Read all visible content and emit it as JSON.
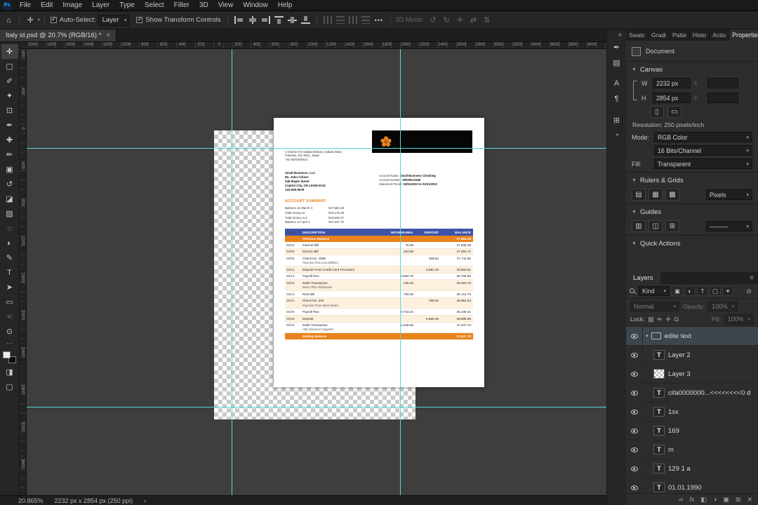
{
  "app": {
    "title_tab": "Italy id.psd @ 20.7% (RGB/16) *",
    "close_glyph": "×",
    "app_icon": "Ps"
  },
  "menubar": {
    "items": [
      "File",
      "Edit",
      "Image",
      "Layer",
      "Type",
      "Select",
      "Filter",
      "3D",
      "View",
      "Window",
      "Help"
    ]
  },
  "options_bar": {
    "home_icon": "⌂",
    "tool_icon": "✛",
    "auto_select": {
      "checked": true,
      "label": "Auto-Select:",
      "value": "Layer"
    },
    "show_transform": {
      "checked": true,
      "label": "Show Transform Controls"
    },
    "align_icons": [
      {
        "name": "align-left-edges-icon",
        "variant": "a-l"
      },
      {
        "name": "align-horizontal-centers-icon",
        "variant": "a-ch"
      },
      {
        "name": "align-right-edges-icon",
        "variant": "a-r"
      },
      {
        "name": "align-top-edges-icon",
        "variant": "a-t"
      },
      {
        "name": "align-vertical-centers-icon",
        "variant": "a-cv"
      },
      {
        "name": "align-bottom-edges-icon",
        "variant": "a-b"
      }
    ],
    "distribute_icons": [
      {
        "name": "distribute-horizontal-icon",
        "variant": "v"
      },
      {
        "name": "distribute-vertical-icon",
        "variant": "h"
      },
      {
        "name": "distribute-spacing-h-icon",
        "variant": "v"
      },
      {
        "name": "distribute-spacing-v-icon",
        "variant": "h"
      }
    ],
    "more_icon": "•••",
    "mode_3d_label": "3D Mode:",
    "mode_3d_icons": [
      {
        "name": "3d-orbit-icon",
        "glyph": "↺"
      },
      {
        "name": "3d-roll-icon",
        "glyph": "↻"
      },
      {
        "name": "3d-pan-icon",
        "glyph": "✛"
      },
      {
        "name": "3d-slide-icon",
        "glyph": "⇄"
      },
      {
        "name": "3d-scale-icon",
        "glyph": "⇅"
      }
    ]
  },
  "rulers": {
    "top": [
      "2000",
      "1800",
      "1600",
      "1400",
      "1200",
      "1000",
      "800",
      "600",
      "400",
      "200",
      "0",
      "200",
      "400",
      "600",
      "800",
      "1000",
      "1200",
      "1400",
      "1600",
      "1800",
      "2000",
      "2200",
      "2400",
      "2600",
      "2800",
      "3000",
      "3200",
      "3400",
      "3600",
      "3800",
      "4000"
    ],
    "left": [
      "800",
      "400",
      "0",
      "400",
      "800",
      "1200",
      "1600",
      "2000",
      "2400",
      "2800",
      "3200",
      "3600",
      "4000"
    ]
  },
  "tools": [
    {
      "name": "move-tool",
      "glyph": "✛",
      "active": true
    },
    {
      "name": "rectangular-marquee-tool",
      "glyph": "▢"
    },
    {
      "name": "lasso-tool",
      "glyph": "✐"
    },
    {
      "name": "quick-selection-tool",
      "glyph": "✦"
    },
    {
      "name": "crop-tool",
      "glyph": "⊡"
    },
    {
      "name": "eyedropper-tool",
      "glyph": "✒"
    },
    {
      "name": "spot-healing-brush-tool",
      "glyph": "✚"
    },
    {
      "name": "brush-tool",
      "glyph": "✏"
    },
    {
      "name": "clone-stamp-tool",
      "glyph": "▣"
    },
    {
      "name": "history-brush-tool",
      "glyph": "↺"
    },
    {
      "name": "eraser-tool",
      "glyph": "◪"
    },
    {
      "name": "gradient-tool",
      "glyph": "▨"
    },
    {
      "name": "blur-tool",
      "glyph": "◌"
    },
    {
      "name": "dodge-tool",
      "glyph": "◐"
    },
    {
      "name": "pen-tool",
      "glyph": "✎"
    },
    {
      "name": "type-tool",
      "glyph": "T"
    },
    {
      "name": "path-selection-tool",
      "glyph": "➤"
    },
    {
      "name": "rectangle-tool",
      "glyph": "▭"
    },
    {
      "name": "hand-tool",
      "glyph": "☜"
    },
    {
      "name": "zoom-tool",
      "glyph": "⊙"
    }
  ],
  "toolbar_extras": {
    "more_icon": "⋯",
    "quick_mask_icon": "◨",
    "screen_mode_icon": "▢"
  },
  "dock_strip": {
    "collapse_icon": "«",
    "icons": [
      {
        "name": "brush-settings-panel-icon",
        "glyph": "✒"
      },
      {
        "name": "clone-source-panel-icon",
        "glyph": "▤"
      },
      {
        "name": "character-panel-icon",
        "glyph": "A"
      },
      {
        "name": "paragraph-panel-icon",
        "glyph": "¶"
      },
      {
        "name": "glyphs-panel-icon",
        "glyph": "⊞"
      },
      {
        "name": "history-panel-icon",
        "glyph": "◔"
      }
    ]
  },
  "statement": {
    "address_lines": [
      "1 Chome-3-6 Hakata Ekimae, Hakata Ward,",
      "Fukuoka, 812-0011, Japan",
      "+81-9267626910"
    ],
    "sender_lines": [
      "Small Business, LLC",
      "Mr. John Citizen",
      "345 Maple Street",
      "Capitol City, OH 12345-0123",
      "123-555-5678"
    ],
    "account_info": [
      {
        "label": "Account Name: ",
        "value": "Small Business Checking"
      },
      {
        "label": "Account Number: ",
        "value": "00000012345"
      },
      {
        "label": "Statement Period: ",
        "value": "03/01/2023 to 03/31/2023"
      }
    ],
    "summary_title": "ACCOUNT SUMMARY",
    "summary_rows": [
      {
        "label": "Balance on March 1:",
        "value": "¥27,584.38"
      },
      {
        "label": "Total money in:",
        "value": "¥10,175.39"
      },
      {
        "label": "Total money out:",
        "value": "¥10,530.07"
      },
      {
        "label": "Balance on April 1:",
        "value": "¥27,347.70"
      }
    ],
    "table": {
      "headers": [
        "DATE",
        "DESCRIPTION",
        "WITHDRAWAL",
        "DEPOSIT",
        "BALANCE"
      ],
      "previous_balance": {
        "label": "Previous Balance",
        "balance": "27,584.38"
      },
      "rows": [
        {
          "date": "03/02",
          "desc": "Internet Bill",
          "desc2": "",
          "withdrawal": "75.99",
          "deposit": "",
          "balance": "27,508.39"
        },
        {
          "date": "03/05",
          "desc": "Electric Bill",
          "desc2": "",
          "withdrawal": "253.68",
          "deposit": "",
          "balance": "27,254.71"
        },
        {
          "date": "03/06",
          "desc": "Check No. 4598",
          "desc2": "Payment from Lisa Williams",
          "withdrawal": "",
          "deposit": "456.84",
          "balance": "27,711.55"
        },
        {
          "date": "03/10",
          "desc": "Deposit From Credit Card Processor",
          "desc2": "",
          "withdrawal": "",
          "deposit": "5,891.26",
          "balance": "33,602.81"
        },
        {
          "date": "03/12",
          "desc": "Payroll Run",
          "desc2": "",
          "withdrawal": "3,894.75",
          "deposit": "",
          "balance": "29,708.06"
        },
        {
          "date": "03/16",
          "desc": "Debit Transaction",
          "desc2": "Main Office Wholesale",
          "withdrawal": "245.36",
          "deposit": "",
          "balance": "29,462.70"
        },
        {
          "date": "03/21",
          "desc": "Rent Bill",
          "desc2": "",
          "withdrawal": "750.00",
          "deposit": "",
          "balance": "28,712.70"
        },
        {
          "date": "03/21",
          "desc": "Check No. 234",
          "desc2": "Payment From Mark Moore",
          "withdrawal": "",
          "deposit": "268.84",
          "balance": "28,981.54"
        },
        {
          "date": "03/25",
          "desc": "Payroll Run",
          "desc2": "",
          "withdrawal": "3,743.23",
          "deposit": "",
          "balance": "25,238.31"
        },
        {
          "date": "03/28",
          "desc": "Deposit",
          "desc2": "",
          "withdrawal": "",
          "deposit": "5,656.45",
          "balance": "28,896.66"
        },
        {
          "date": "03/29",
          "desc": "Debit Transaction",
          "desc2": "ABC Business Supplies",
          "withdrawal": "1,548.96",
          "deposit": "",
          "balance": "27,347.70"
        }
      ],
      "ending_balance": {
        "label": "Ending Balance",
        "balance": "27,347.70"
      }
    },
    "colors": {
      "header_blue": "#3d54a8",
      "accent_orange": "#e8821c"
    }
  },
  "properties_panel": {
    "tabs": [
      "Swatc",
      "Gradi",
      "Patte",
      "Histo",
      "Actio"
    ],
    "properties_tab": "Properties",
    "document_label": "Document",
    "canvas": {
      "title": "Canvas",
      "w_label": "W",
      "w_value": "2232 px",
      "x_label": "X",
      "h_label": "H",
      "h_value": "2854 px",
      "y_label": "Y",
      "resolution": "Resolution: 250 pixels/inch",
      "mode_label": "Mode:",
      "mode_value": "RGB Color",
      "depth_value": "16 Bits/Channel",
      "fill_label": "Fill:",
      "fill_value": "Transparent",
      "orient_icons": [
        {
          "name": "canvas-portrait-icon",
          "glyph": "▯"
        },
        {
          "name": "canvas-landscape-icon",
          "glyph": "▭"
        }
      ]
    },
    "rulers_grids": {
      "title": "Rulers & Grids",
      "units_value": "Pixels",
      "icons": [
        {
          "name": "toggle-rulers-icon",
          "glyph": "▤"
        },
        {
          "name": "toggle-grid-icon",
          "glyph": "▦"
        },
        {
          "name": "toggle-snap-icon",
          "glyph": "▩"
        }
      ]
    },
    "guides": {
      "title": "Guides",
      "line_style_value": "———",
      "icons": [
        {
          "name": "toggle-guides-icon",
          "glyph": "▥"
        },
        {
          "name": "lock-guides-icon",
          "glyph": "◫"
        },
        {
          "name": "new-guide-layout-icon",
          "glyph": "⊞"
        }
      ]
    },
    "quick_actions": {
      "title": "Quick Actions"
    }
  },
  "layers_panel": {
    "tab_label": "Layers",
    "menu_icon": "≡",
    "kind_value": "Kind",
    "filter_icons": [
      {
        "name": "filter-pixel-layers-icon",
        "glyph": "▣"
      },
      {
        "name": "filter-adjustment-layers-icon",
        "glyph": "◐"
      },
      {
        "name": "filter-type-layers-icon",
        "glyph": "T"
      },
      {
        "name": "filter-shape-layers-icon",
        "glyph": "▢"
      },
      {
        "name": "filter-smart-objects-icon",
        "glyph": "✦"
      }
    ],
    "filter_toggle_icon": "⊙",
    "blend_mode": "Normal",
    "opacity_label": "Opacity:",
    "opacity_value": "100%",
    "lock_label": "Lock:",
    "lock_icons": [
      {
        "name": "lock-transparency-icon",
        "glyph": "▨"
      },
      {
        "name": "lock-pixels-icon",
        "glyph": "✏"
      },
      {
        "name": "lock-position-icon",
        "glyph": "✛"
      },
      {
        "name": "lock-all-icon",
        "glyph": "Ω"
      }
    ],
    "fill_label": "Fill:",
    "fill_value": "100%",
    "type_icon_glyph": "T",
    "group_chevron": "▾",
    "layers": [
      {
        "type": "group",
        "name": "edite text",
        "indent": 0,
        "selected": true,
        "eye": true
      },
      {
        "type": "text",
        "name": "Layer 2",
        "indent": 1,
        "eye": true
      },
      {
        "type": "raster",
        "name": "Layer 3",
        "indent": 1,
        "eye": true
      },
      {
        "type": "text",
        "name": "cifa0000000...<<<<<<<<0 d",
        "indent": 1,
        "eye": true
      },
      {
        "type": "text",
        "name": "1sx",
        "indent": 1,
        "eye": true
      },
      {
        "type": "text",
        "name": "169",
        "indent": 1,
        "eye": true
      },
      {
        "type": "text",
        "name": "m",
        "indent": 1,
        "eye": true
      },
      {
        "type": "text",
        "name": "129 1 a",
        "indent": 1,
        "eye": true
      },
      {
        "type": "text",
        "name": "01.01.1990",
        "indent": 1,
        "eye": true
      }
    ],
    "footer_icons": [
      {
        "name": "link-layers-icon",
        "glyph": "∞"
      },
      {
        "name": "layer-effects-icon",
        "glyph": "fx"
      },
      {
        "name": "layer-mask-icon",
        "glyph": "◧"
      },
      {
        "name": "adjustment-layer-icon",
        "glyph": "◑"
      },
      {
        "name": "layer-group-icon",
        "glyph": "▣"
      },
      {
        "name": "new-layer-icon",
        "glyph": "⊞"
      },
      {
        "name": "delete-layer-icon",
        "glyph": "✕"
      }
    ]
  },
  "status_bar": {
    "zoom": "20.865%",
    "doc_info": "2232 px x 2854 px (250 ppi)",
    "caret": "›"
  },
  "ui_colors": {
    "guide_cyan": "#55d7db",
    "accent_blue": "#31a8ff"
  }
}
